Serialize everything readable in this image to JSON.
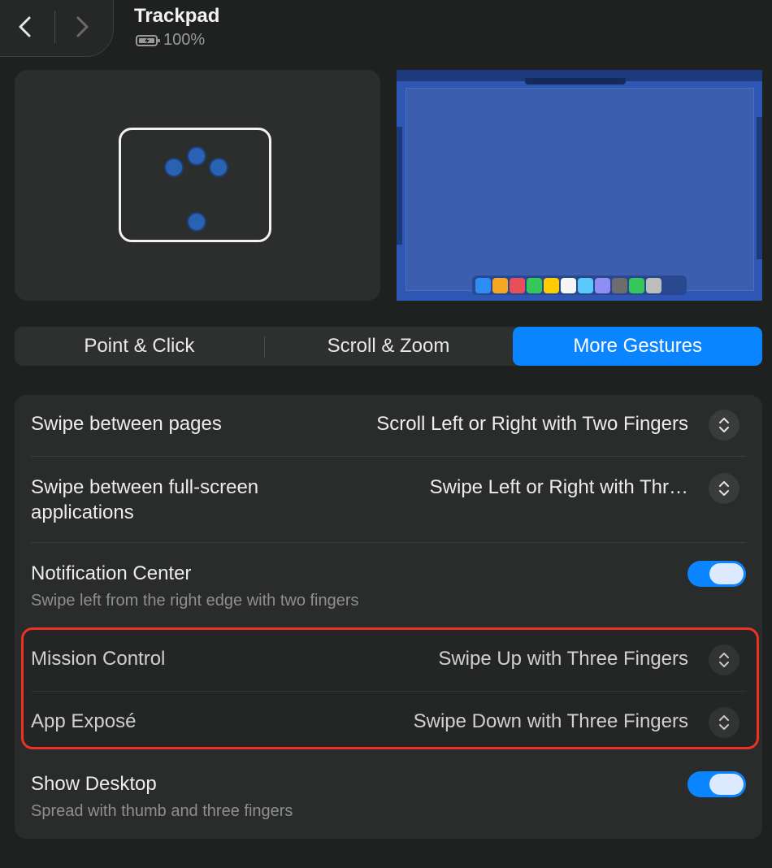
{
  "header": {
    "title": "Trackpad",
    "battery_level": "100%",
    "back_icon": "chevron-left-icon",
    "forward_icon": "chevron-right-icon",
    "battery_icon": "battery-charging-icon"
  },
  "tabs": [
    {
      "label": "Point & Click",
      "active": false
    },
    {
      "label": "Scroll & Zoom",
      "active": false
    },
    {
      "label": "More Gestures",
      "active": true
    }
  ],
  "settings": {
    "swipe_pages": {
      "label": "Swipe between pages",
      "value": "Scroll Left or Right with Two Fingers"
    },
    "swipe_fullscreen": {
      "label_line1": "Swipe between full-screen",
      "label_line2": "applications",
      "value": "Swipe Left or Right with Thr…"
    },
    "notification_center": {
      "label": "Notification Center",
      "sub": "Swipe left from the right edge with two fingers",
      "enabled": true
    },
    "mission_control": {
      "label": "Mission Control",
      "value": "Swipe Up with Three Fingers"
    },
    "app_expose": {
      "label": "App Exposé",
      "value": "Swipe Down with Three Fingers"
    },
    "show_desktop": {
      "label": "Show Desktop",
      "sub": "Spread with thumb and three fingers",
      "enabled": true
    }
  },
  "colors": {
    "accent": "#0a84ff",
    "highlight": "#ea3323",
    "background": "#1f2020",
    "panel": "#2a2b2b"
  },
  "dock_colors": [
    "#2f8cf5",
    "#f5a623",
    "#e94f5b",
    "#35c759",
    "#ffcc00",
    "#f5f5f5",
    "#5ac8fa",
    "#8e8ef5",
    "#6d6d6d",
    "#35c759",
    "#bdbdbd"
  ]
}
